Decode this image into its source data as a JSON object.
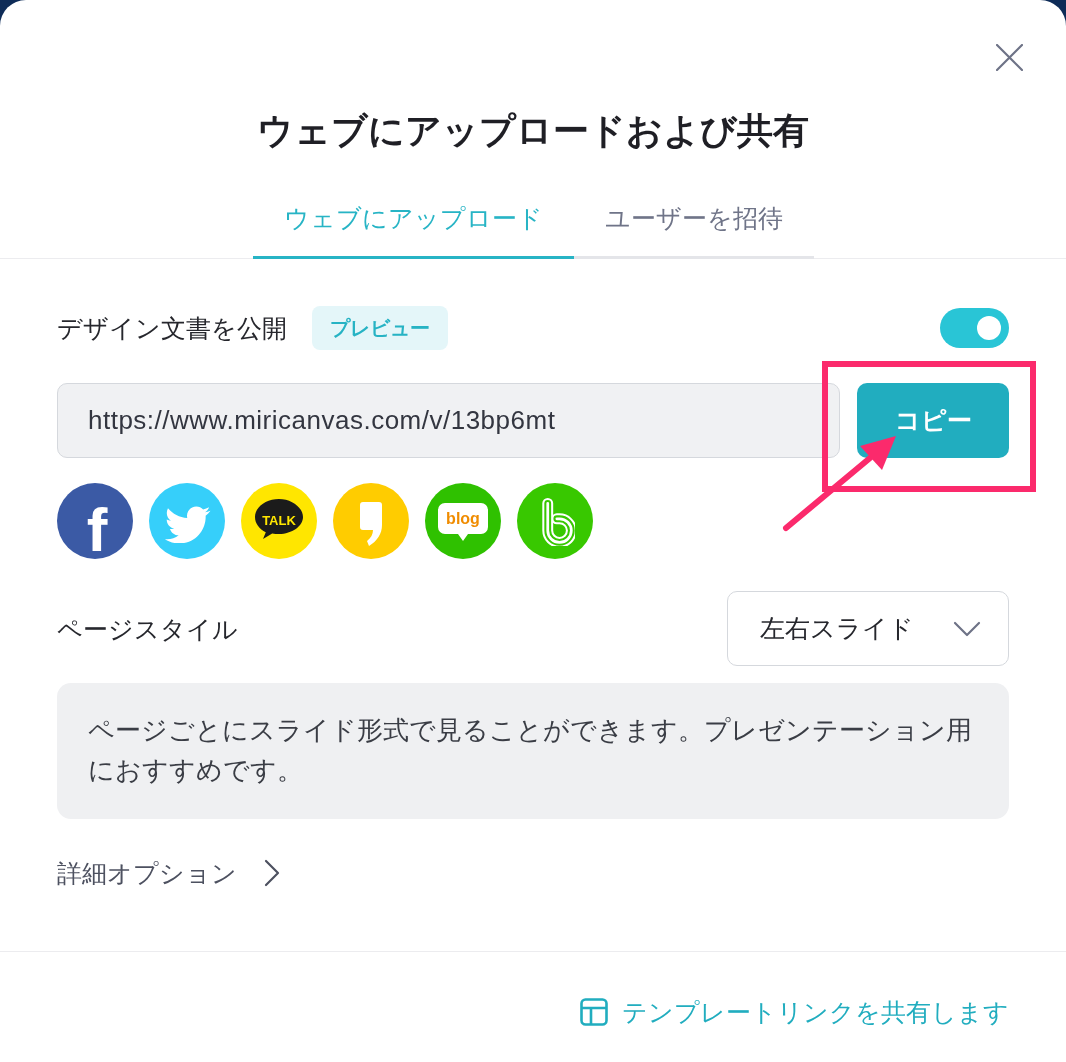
{
  "dialog": {
    "title": "ウェブにアップロードおよび共有"
  },
  "tabs": [
    {
      "label": "ウェブにアップロード",
      "selected": true
    },
    {
      "label": "ユーザーを招待",
      "selected": false
    }
  ],
  "publish": {
    "label": "デザイン文書を公開",
    "badge": "プレビュー",
    "on": true
  },
  "link": {
    "value": "https://www.miricanvas.com/v/13bp6mt",
    "button": "コピー"
  },
  "share_buttons": [
    {
      "kind": "facebook",
      "text": "f"
    },
    {
      "kind": "twitter"
    },
    {
      "kind": "kakaotalk",
      "text": "TALK"
    },
    {
      "kind": "kakaostory"
    },
    {
      "kind": "blog",
      "text": "blog"
    },
    {
      "kind": "band"
    }
  ],
  "page_style": {
    "label": "ページスタイル",
    "value": "左右スライド",
    "description": "ページごとにスライド形式で見ることができます。プレゼンテーション用におすすめです。"
  },
  "advanced_options": {
    "label": "詳細オプション",
    "expanded": false
  },
  "footer_link": {
    "label": "テンプレートリンクを共有します"
  },
  "callout": {
    "frame": true,
    "arrow": true
  }
}
